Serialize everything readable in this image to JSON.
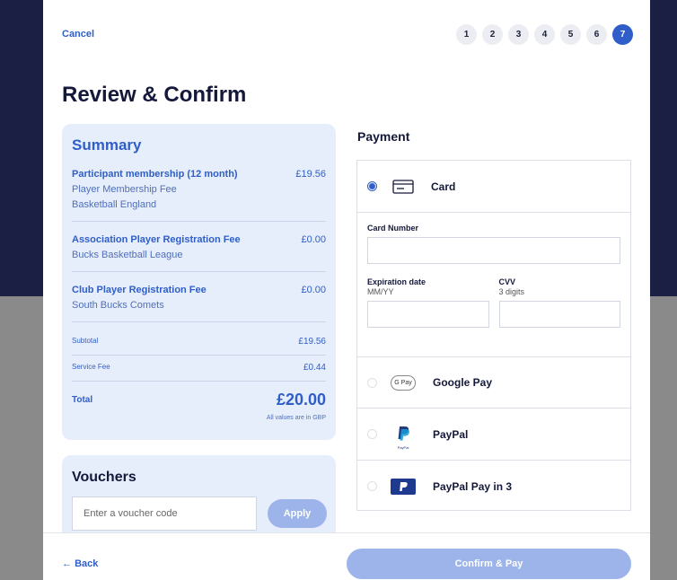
{
  "header": {
    "cancel_label": "Cancel",
    "steps": [
      "1",
      "2",
      "3",
      "4",
      "5",
      "6",
      "7"
    ],
    "active_step": "7"
  },
  "page_title": "Review & Confirm",
  "summary": {
    "title": "Summary",
    "items": [
      {
        "title": "Participant membership (12 month)",
        "price": "£19.56",
        "subs": [
          "Player Membership Fee",
          "Basketball England"
        ]
      },
      {
        "title": "Association Player Registration Fee",
        "price": "£0.00",
        "subs": [
          "Bucks Basketball League"
        ]
      },
      {
        "title": "Club Player Registration Fee",
        "price": "£0.00",
        "subs": [
          "South Bucks Comets"
        ]
      }
    ],
    "subtotal_label": "Subtotal",
    "subtotal_value": "£19.56",
    "service_fee_label": "Service Fee",
    "service_fee_value": "£0.44",
    "total_label": "Total",
    "total_value": "£20.00",
    "currency_note": "All values are in GBP"
  },
  "vouchers": {
    "title": "Vouchers",
    "input_placeholder": "Enter a voucher code",
    "apply_label": "Apply"
  },
  "payment": {
    "title": "Payment",
    "card_label": "Card",
    "card_number_label": "Card Number",
    "expiration_label": "Expiration date",
    "expiration_hint": "MM/YY",
    "cvv_label": "CVV",
    "cvv_hint": "3 digits",
    "google_pay_label": "Google Pay",
    "google_pay_badge": "G Pay",
    "paypal_label": "PayPal",
    "paypal_badge": "PayPal",
    "paypal_pay_in_3_label": "PayPal Pay in 3",
    "selected_method": "Card"
  },
  "footer": {
    "back_label": "Back",
    "confirm_label": "Confirm & Pay"
  },
  "colors": {
    "accent": "#2f5ec8",
    "disabled_button": "#9cb4ea",
    "summary_bg": "#e7eefb",
    "backdrop_top": "#1b1f44",
    "backdrop_bottom": "#8a8a8a"
  }
}
